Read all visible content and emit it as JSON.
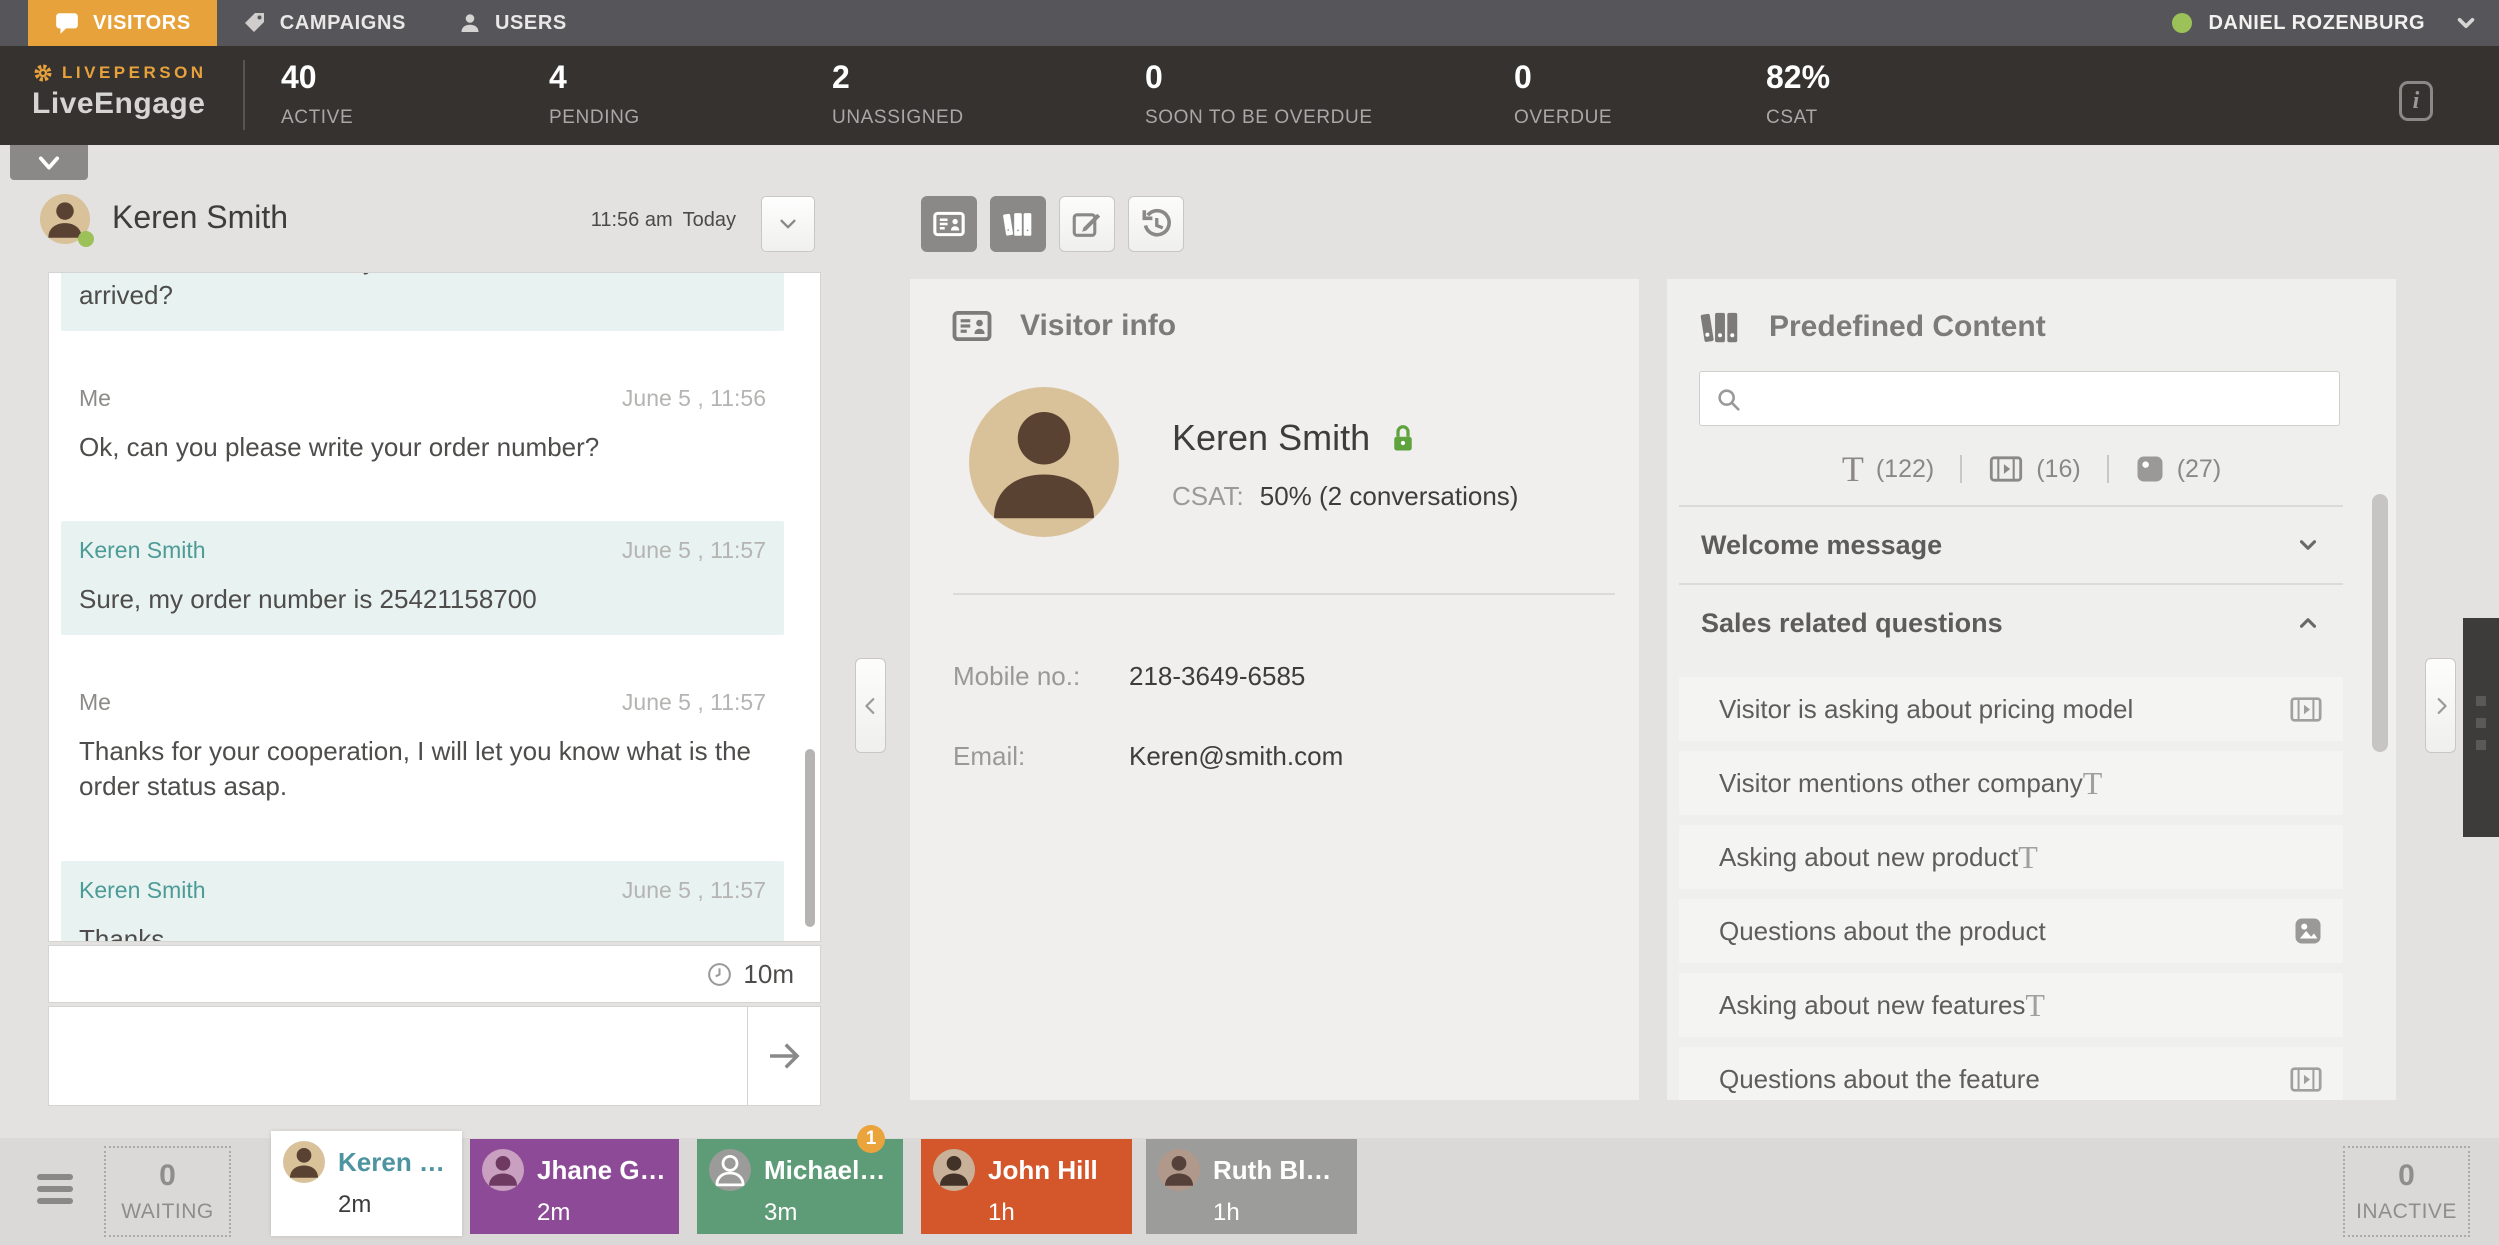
{
  "colors": {
    "accent_orange": "#E7A23B",
    "teal": "#4D9B97",
    "status_green": "#9BC158",
    "lock_green": "#5FA33E",
    "badge_orange": "#EBA43C"
  },
  "top_nav": {
    "tabs": [
      {
        "label": "VISITORS"
      },
      {
        "label": "CAMPAIGNS"
      },
      {
        "label": "USERS"
      }
    ],
    "user_name": "DANIEL ROZENBURG"
  },
  "brand": {
    "company": "LIVEPERSON",
    "product": "LiveEngage"
  },
  "stats": [
    {
      "value": "40",
      "label": "ACTIVE"
    },
    {
      "value": "4",
      "label": "PENDING"
    },
    {
      "value": "2",
      "label": "UNASSIGNED"
    },
    {
      "value": "0",
      "label": "SOON TO BE OVERDUE"
    },
    {
      "value": "0",
      "label": "OVERDUE"
    },
    {
      "value": "82%",
      "label": "CSAT"
    }
  ],
  "info_icon": "i",
  "chat": {
    "name": "Keren Smith",
    "time": "11:56 am",
    "day": "Today",
    "timer": "10m",
    "messages": [
      {
        "text": "Hello, I'd like to know why the item I've ordered still hasn't arrived?"
      },
      {
        "sender": "Me",
        "time": "June 5 , 11:56",
        "text": "Ok, can you please write your order number?"
      },
      {
        "sender": "Keren Smith",
        "time": "June 5 , 11:57",
        "text": "Sure, my order number is 25421158700"
      },
      {
        "sender": "Me",
        "time": "June 5 , 11:57",
        "text": "Thanks for your cooperation, I will let you know what is the order status asap."
      },
      {
        "sender": "Keren Smith",
        "time": "June 5 , 11:57",
        "text": "Thanks."
      }
    ]
  },
  "visitor_info": {
    "title": "Visitor info",
    "name": "Keren Smith",
    "csat_label": "CSAT:",
    "csat_value": "50% (2 conversations)",
    "fields": [
      {
        "label": "Mobile no.:",
        "value": "218-3649-6585"
      },
      {
        "label": "Email:",
        "value": "Keren@smith.com"
      }
    ]
  },
  "predefined": {
    "title": "Predefined Content",
    "filters": [
      {
        "type": "text",
        "count": "(122)"
      },
      {
        "type": "video",
        "count": "(16)"
      },
      {
        "type": "image",
        "count": "(27)"
      }
    ],
    "sections": [
      {
        "label": "Welcome message"
      },
      {
        "label": "Sales related questions"
      }
    ],
    "items": [
      {
        "label": "Visitor is asking about pricing model",
        "type": "video"
      },
      {
        "label": "Visitor mentions other company",
        "type": "text"
      },
      {
        "label": "Asking about new product",
        "type": "text"
      },
      {
        "label": "Questions about the product",
        "type": "image"
      },
      {
        "label": "Asking about new features",
        "type": "text"
      },
      {
        "label": "Questions about the feature",
        "type": "video"
      }
    ]
  },
  "bottom_bar": {
    "waiting_value": "0",
    "waiting_label": "WAITING",
    "inactive_value": "0",
    "inactive_label": "INACTIVE",
    "tabs": [
      {
        "name": "Keren Smith",
        "time": "2m",
        "color": "#FFFFFF"
      },
      {
        "name": "Jhane Grham",
        "time": "2m",
        "color": "#8C4A97"
      },
      {
        "name": "Michael Smi..",
        "time": "3m",
        "color": "#5D9C77",
        "badge": "1"
      },
      {
        "name": "John Hill",
        "time": "1h",
        "color": "#D4562B"
      },
      {
        "name": "Ruth Black",
        "time": "1h",
        "color": "#9C9C9A"
      }
    ]
  }
}
